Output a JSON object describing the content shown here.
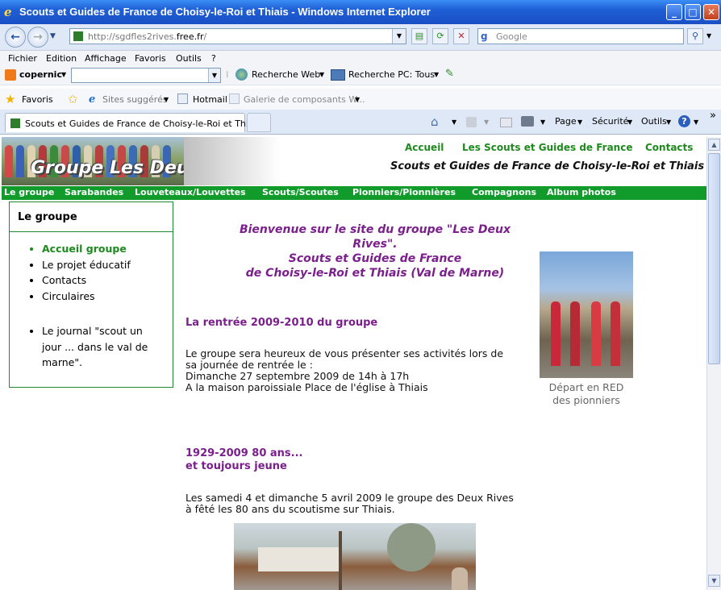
{
  "window": {
    "title": "Scouts et Guides de France de Choisy-le-Roi et Thiais - Windows Internet Explorer",
    "minimize": "_",
    "maximize": "□",
    "close": "✕"
  },
  "address": {
    "url_prefix": "http://sgdfles2rives.",
    "url_domain": "free.fr",
    "url_suffix": "/",
    "search_placeholder": "Google"
  },
  "menu": [
    "Fichier",
    "Edition",
    "Affichage",
    "Favoris",
    "Outils",
    "?"
  ],
  "copernic": {
    "brand": "copernic",
    "web_search": "Recherche Web",
    "pc_search": "Recherche PC: Tous"
  },
  "favorites": {
    "label": "Favoris",
    "suggested": "Sites suggérés",
    "hotmail": "Hotmail",
    "gallery": "Galerie de composants W..."
  },
  "tab": {
    "title": "Scouts et Guides de France de Choisy-le-Roi et Thiais"
  },
  "commandbar": {
    "page": "Page",
    "security": "Sécurité",
    "tools": "Outils",
    "more": "»"
  },
  "site": {
    "logo_text": "Groupe Les Deux Rives",
    "top_links": [
      "Accueil",
      "Les Scouts et Guides de France",
      "Contacts"
    ],
    "tagline": "Scouts et Guides de France de Choisy-le-Roi et Thiais",
    "nav": [
      "Le groupe",
      "Sarabandes",
      "Louveteaux/Louvettes",
      "Scouts/Scoutes",
      "Pionniers/Pionnières",
      "Compagnons",
      "Album photos"
    ],
    "sidebar": {
      "heading": "Le groupe",
      "items": [
        "Accueil groupe",
        "Le projet éducatif",
        "Contacts",
        "Circulaires"
      ],
      "journal_lines": [
        "Le journal \"scout un",
        "jour ... dans le val de",
        "marne\"."
      ]
    },
    "welcome": [
      "Bienvenue sur le site du groupe \"Les Deux",
      "Rives\".",
      "Scouts et Guides de France",
      "de Choisy-le-Roi et Thiais (Val de Marne)"
    ],
    "section1": {
      "heading": "La rentrée 2009-2010 du groupe",
      "lines": [
        "Le groupe sera heureux de vous présenter ses activités lors de",
        "sa journée de rentrée le :",
        "Dimanche 27 septembre 2009 de 14h à 17h",
        "A la maison paroissiale Place de l'église à Thiais"
      ]
    },
    "section2": {
      "heading_lines": [
        "1929-2009 80 ans...",
        "et toujours jeune"
      ],
      "lines": [
        "Les samedi 4 et dimanche 5 avril 2009 le groupe des Deux Rives",
        "à fêté les 80 ans du scoutisme sur Thiais."
      ]
    },
    "photo_caption": [
      "Départ en RED",
      "des pionniers"
    ]
  }
}
